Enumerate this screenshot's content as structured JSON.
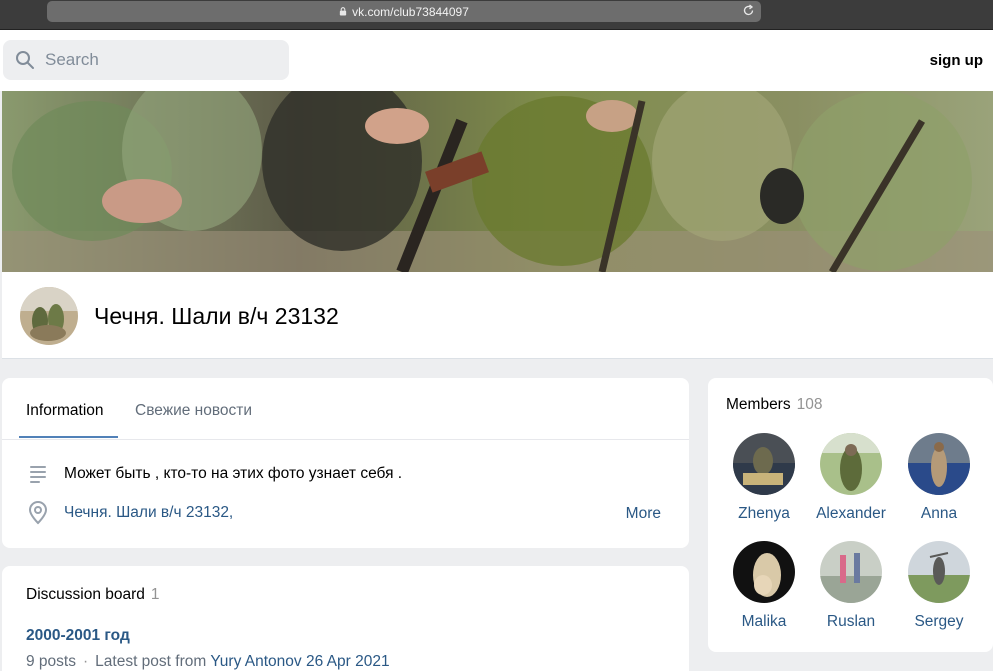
{
  "browser": {
    "url": "vk.com/club73844097"
  },
  "header": {
    "search_placeholder": "Search",
    "signup_label": "sign up"
  },
  "group": {
    "name": "Чечня. Шали в/ч 23132"
  },
  "tabs": [
    {
      "label": "Information"
    },
    {
      "label": "Свежие новости"
    }
  ],
  "info": {
    "description": "Может быть , кто-то на этих фото узнает себя .",
    "location": "Чечня. Шали в/ч 23132,",
    "more_label": "More"
  },
  "discussion": {
    "title": "Discussion board",
    "count": "1",
    "topic": "2000-2001 год",
    "posts": "9 posts",
    "latest_prefix": "Latest post from",
    "latest_author": "Yury Antonov",
    "latest_date": "26 Apr 2021"
  },
  "members": {
    "title": "Members",
    "count": "108",
    "list": [
      {
        "name": "Zhenya"
      },
      {
        "name": "Alexander"
      },
      {
        "name": "Anna"
      },
      {
        "name": "Malika"
      },
      {
        "name": "Ruslan"
      },
      {
        "name": "Sergey"
      }
    ]
  },
  "colors": {
    "link": "#2a5885",
    "accent": "#5181b8",
    "page_bg": "#edeef0"
  }
}
